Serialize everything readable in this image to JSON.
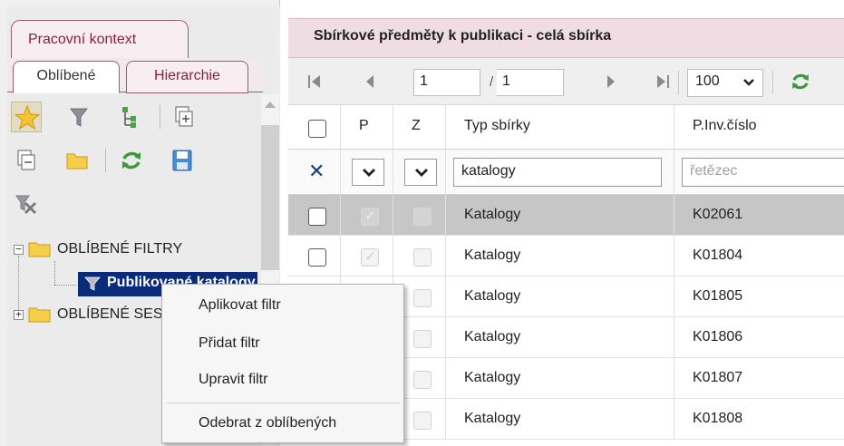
{
  "left_panel": {
    "context_tab": "Pracovní kontext",
    "tabs": [
      {
        "label": "Oblíbené",
        "active": true
      },
      {
        "label": "Hierarchie",
        "active": false
      }
    ],
    "tree": {
      "root1_label": "OBLÍBENÉ FILTRY",
      "root1_child_label": "Publikované katalogy",
      "root2_label": "OBLÍBENÉ SESTAVY"
    }
  },
  "context_menu": {
    "items": [
      "Aplikovat filtr",
      "Přidat filtr",
      "Upravit filtr",
      "Odebrat z oblíbených"
    ]
  },
  "right_panel": {
    "title": "Sbírkové předměty k publikaci - celá sbírka",
    "pager": {
      "current_page": "1",
      "total_pages": "1",
      "separator": "/",
      "page_size": "100"
    },
    "columns": [
      "P",
      "Z",
      "Typ sbírky",
      "P.Inv.číslo"
    ],
    "filters": {
      "typ": "katalogy",
      "inv_placeholder": "řetězec"
    },
    "rows": [
      {
        "typ": "Katalogy",
        "inv": "K02061",
        "selected": true
      },
      {
        "typ": "Katalogy",
        "inv": "K01804",
        "selected": false
      },
      {
        "typ": "Katalogy",
        "inv": "K01805",
        "selected": false
      },
      {
        "typ": "Katalogy",
        "inv": "K01806",
        "selected": false
      },
      {
        "typ": "Katalogy",
        "inv": "K01807",
        "selected": false
      },
      {
        "typ": "Katalogy",
        "inv": "K01808",
        "selected": false
      }
    ]
  },
  "colors": {
    "accent_maroon": "#8a1f3e",
    "tab_bg": "#f8eef1",
    "header_bg": "#f0dde3",
    "tree_selection": "#0a2b7a",
    "row_selection": "#c6c6c6",
    "clear_x": "#163d8c",
    "refresh_green": "#3a9a3a"
  }
}
